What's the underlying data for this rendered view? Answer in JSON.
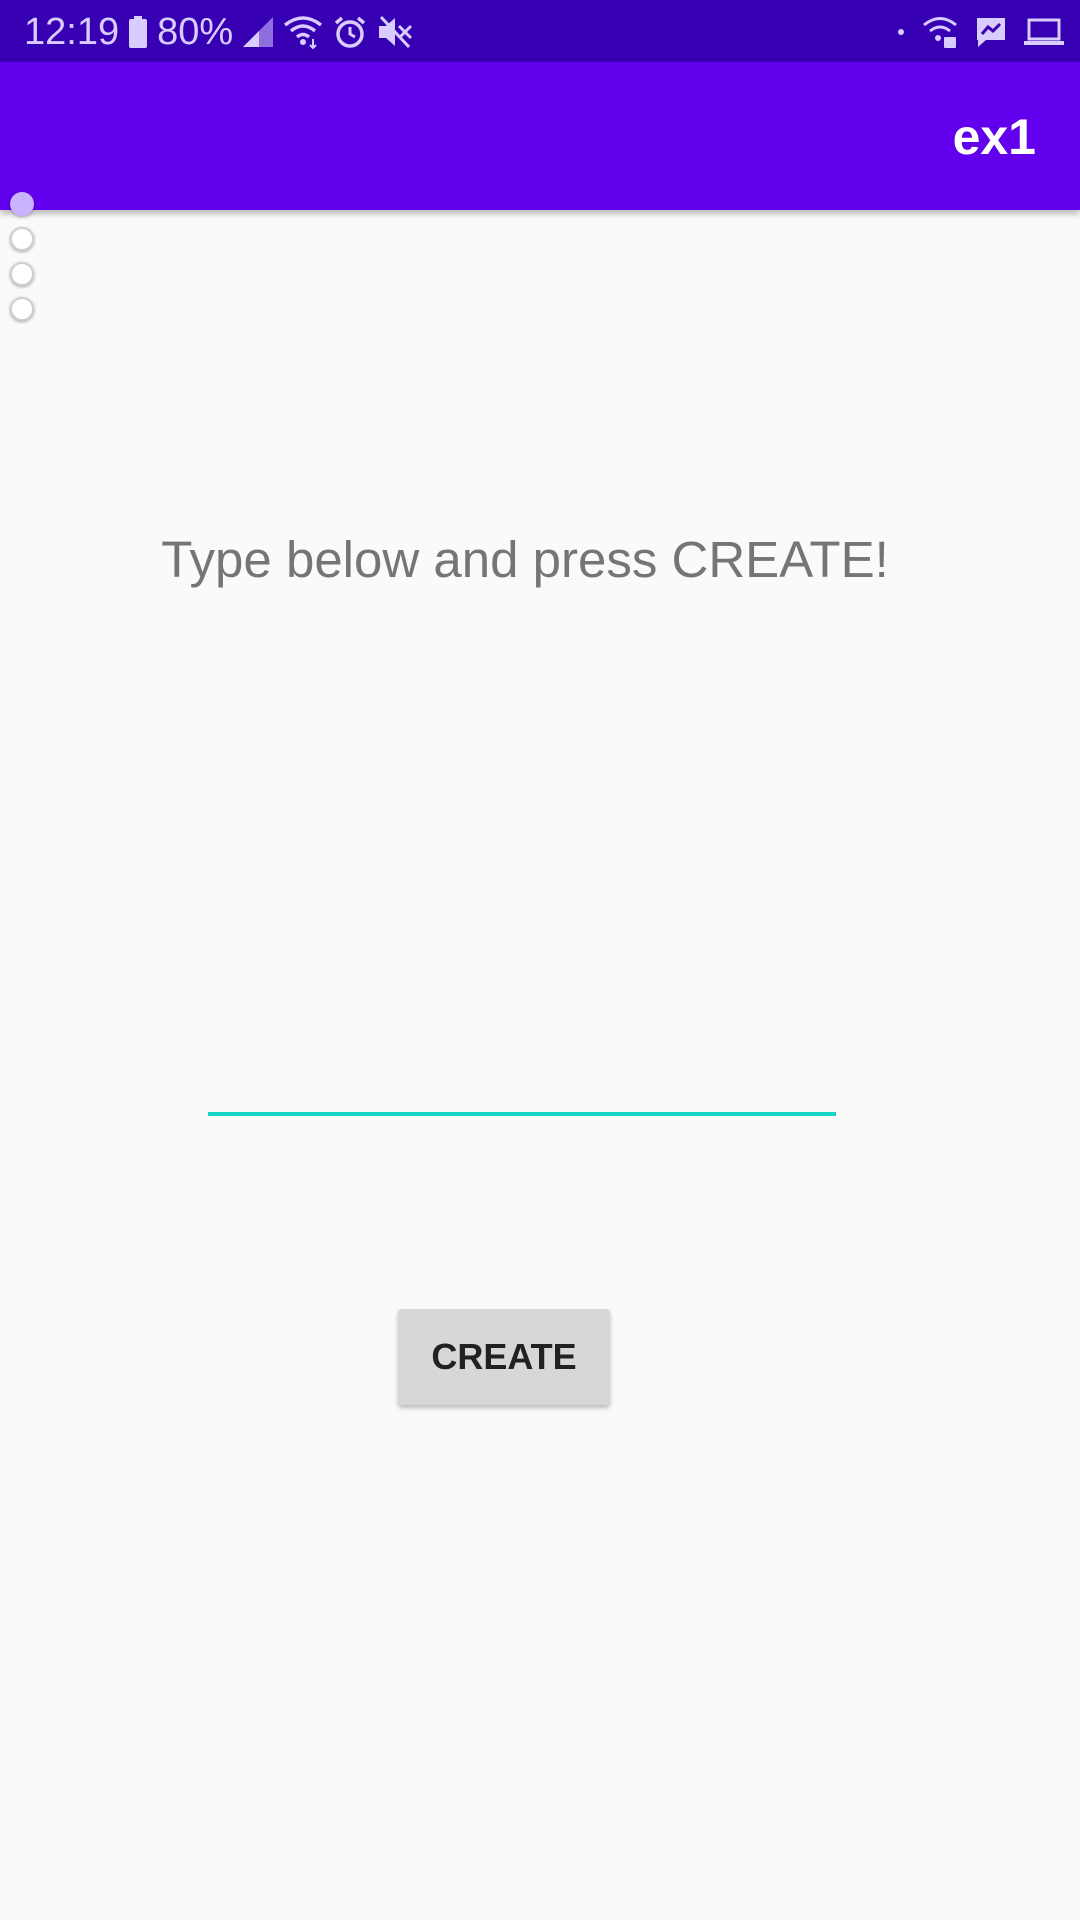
{
  "status_bar": {
    "time": "12:19",
    "battery_percent": "80%",
    "icons_left": [
      "battery-icon",
      "signal-icon",
      "wifi-icon",
      "alarm-icon",
      "mute-icon"
    ],
    "icons_right": [
      "dot-icon",
      "wifi-lock-icon",
      "messenger-icon",
      "laptop-icon"
    ]
  },
  "app_bar": {
    "title": "ex1"
  },
  "radio_group": {
    "options": [
      {
        "selected": true
      },
      {
        "selected": false
      },
      {
        "selected": false
      },
      {
        "selected": false
      }
    ]
  },
  "main": {
    "prompt": "Type below and press CREATE!",
    "input_value": "",
    "create_label": "CREATE"
  },
  "colors": {
    "status_bar": "#3700b3",
    "app_bar": "#6200ee",
    "input_underline": "#18d4c4",
    "button_bg": "#d6d7d7",
    "background": "#fafafa"
  }
}
